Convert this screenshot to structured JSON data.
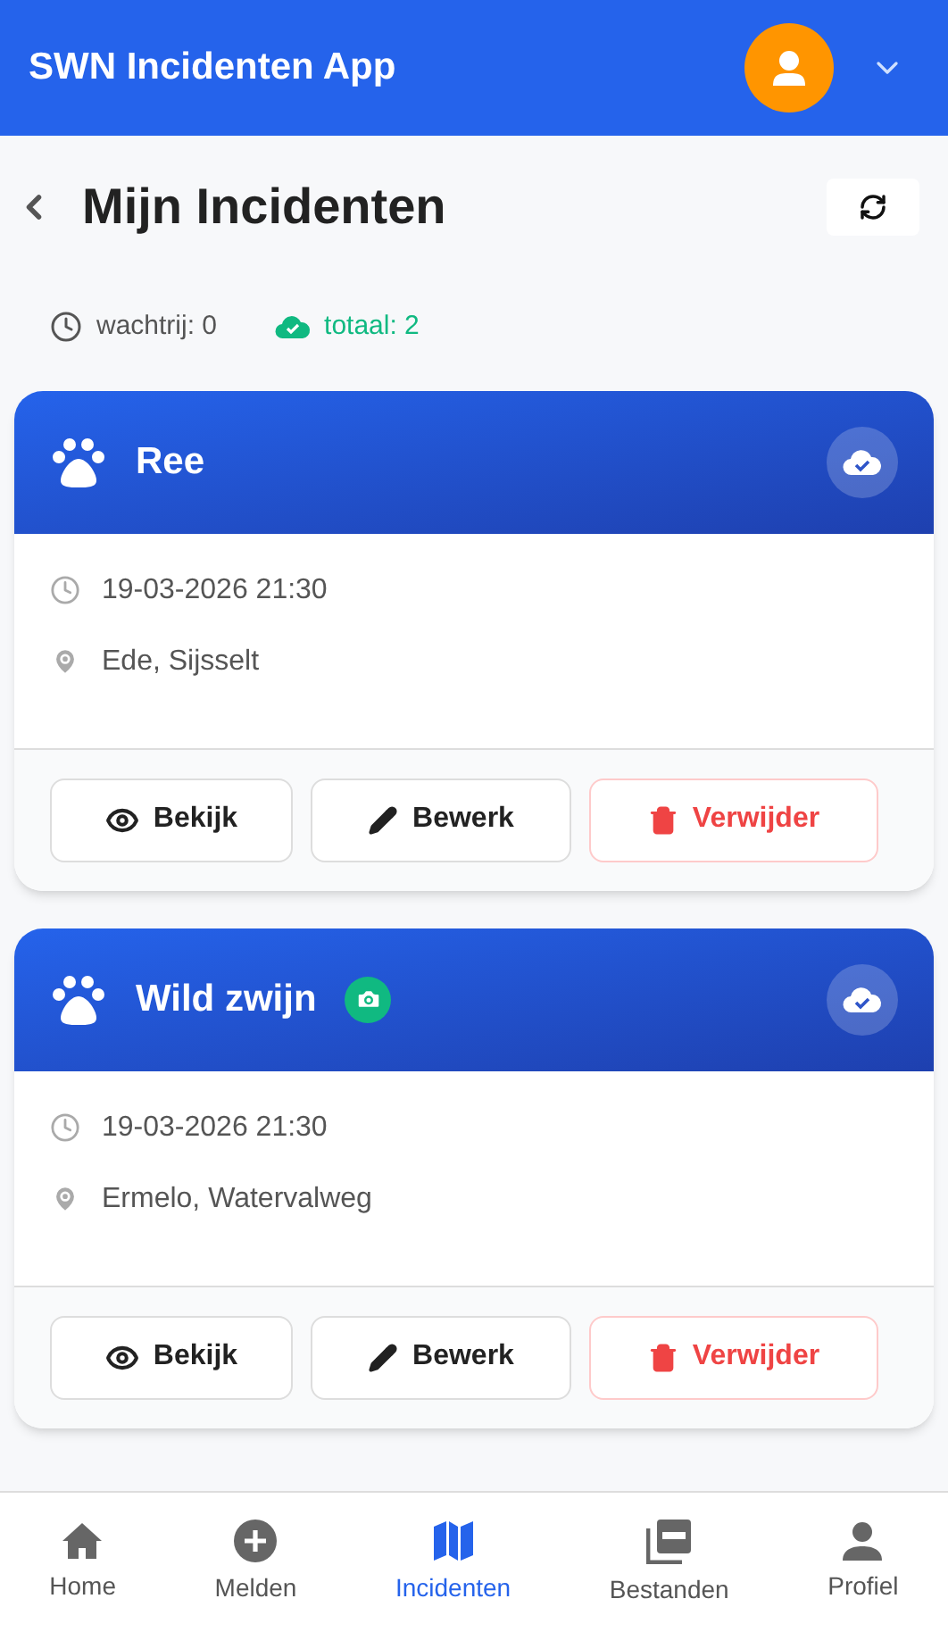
{
  "app_bar": {
    "title": "SWN Incidenten App"
  },
  "page": {
    "title": "Mijn Incidenten"
  },
  "stats": {
    "queue": "wachtrij: 0",
    "total": "totaal: 2"
  },
  "incidents": [
    {
      "animal": "Ree",
      "has_photo": false,
      "synced": true,
      "datetime": "19-03-2026 21:30",
      "location": "Ede, Sijsselt",
      "actions": [
        "Bekijk",
        "Bewerk",
        "Verwijder"
      ]
    },
    {
      "animal": "Wild zwijn",
      "has_photo": true,
      "synced": true,
      "datetime": "19-03-2026 21:30",
      "location": "Ermelo, Watervalweg",
      "actions": [
        "Bekijk",
        "Bewerk",
        "Verwijder"
      ]
    }
  ],
  "nav": [
    {
      "kind": "home",
      "label": "Home",
      "selected": false
    },
    {
      "kind": "add",
      "label": "Melden",
      "selected": false
    },
    {
      "kind": "map",
      "label": "Incidenten",
      "selected": true
    },
    {
      "kind": "pdf",
      "label": "Bestanden",
      "selected": false
    },
    {
      "kind": "person",
      "label": "Profiel",
      "selected": false
    }
  ]
}
